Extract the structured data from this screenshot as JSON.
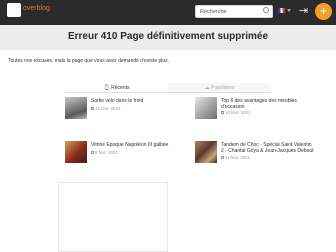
{
  "header": {
    "brand": "overblog",
    "search_placeholder": "Recherche",
    "login_icon": "login-icon",
    "create_icon": "plus-icon",
    "accent_color": "#f0a028"
  },
  "page": {
    "title": "Erreur 410 Page définitivement supprimée",
    "error_text": "Toutes nos excuses, mais la page que vous avez demandé n'existe plus."
  },
  "tabs": {
    "recent": "Récents",
    "popular": "Populaires"
  },
  "articles": [
    {
      "title": "Sortie vélo dans le froid",
      "date": "12 févr. 2021"
    },
    {
      "title": "Top 6 des avantages des meubles d'occasion",
      "date": "10 févr. 2021"
    },
    {
      "title": "Vitrine Epoque Napoléon III galbée",
      "date": "9 févr. 2021"
    },
    {
      "title": "Tandem de Choc - Spécial Saint Valentin",
      "title2": "2 - Chantal Goya & Jean-Jacques Debout",
      "date": "11 févr. 2021"
    }
  ]
}
